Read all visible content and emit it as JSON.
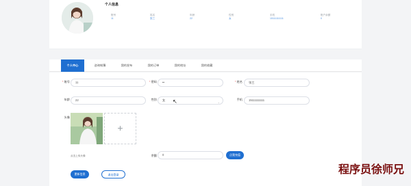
{
  "profile": {
    "title": "个人信息",
    "fields": [
      {
        "label": "账号",
        "value": "11"
      },
      {
        "label": "姓名",
        "value": "张三"
      },
      {
        "label": "年龄",
        "value": "22"
      },
      {
        "label": "性别",
        "value": "女"
      },
      {
        "label": "手机",
        "value": "15111111111"
      },
      {
        "label": "账户余额",
        "value": "0"
      }
    ]
  },
  "tabs": [
    {
      "label": "个人中心",
      "active": true
    },
    {
      "label": "咨询帐簿"
    },
    {
      "label": "我的发布"
    },
    {
      "label": "我的订单"
    },
    {
      "label": "我的地址"
    },
    {
      "label": "我的收藏"
    }
  ],
  "form": {
    "account_label": "账号",
    "account_value": "11",
    "password_label": "密码",
    "password_value": "••",
    "name_label": "姓名",
    "name_value": "张三",
    "age_label": "年龄",
    "age_value": "22",
    "gender_label": "性别",
    "gender_value": "女",
    "phone_label": "手机",
    "phone_value": "15111111111",
    "avatar_label": "头像",
    "upload_hint": "点击上传头像",
    "balance_label": "余额",
    "balance_value": "0",
    "recharge_button": "点我充值",
    "update_button": "更新信息",
    "logout_button": "退出登录"
  },
  "watermark": "程序员徐师兄",
  "colors": {
    "accent": "#1f6fd1",
    "watermark": "#7a1010"
  }
}
